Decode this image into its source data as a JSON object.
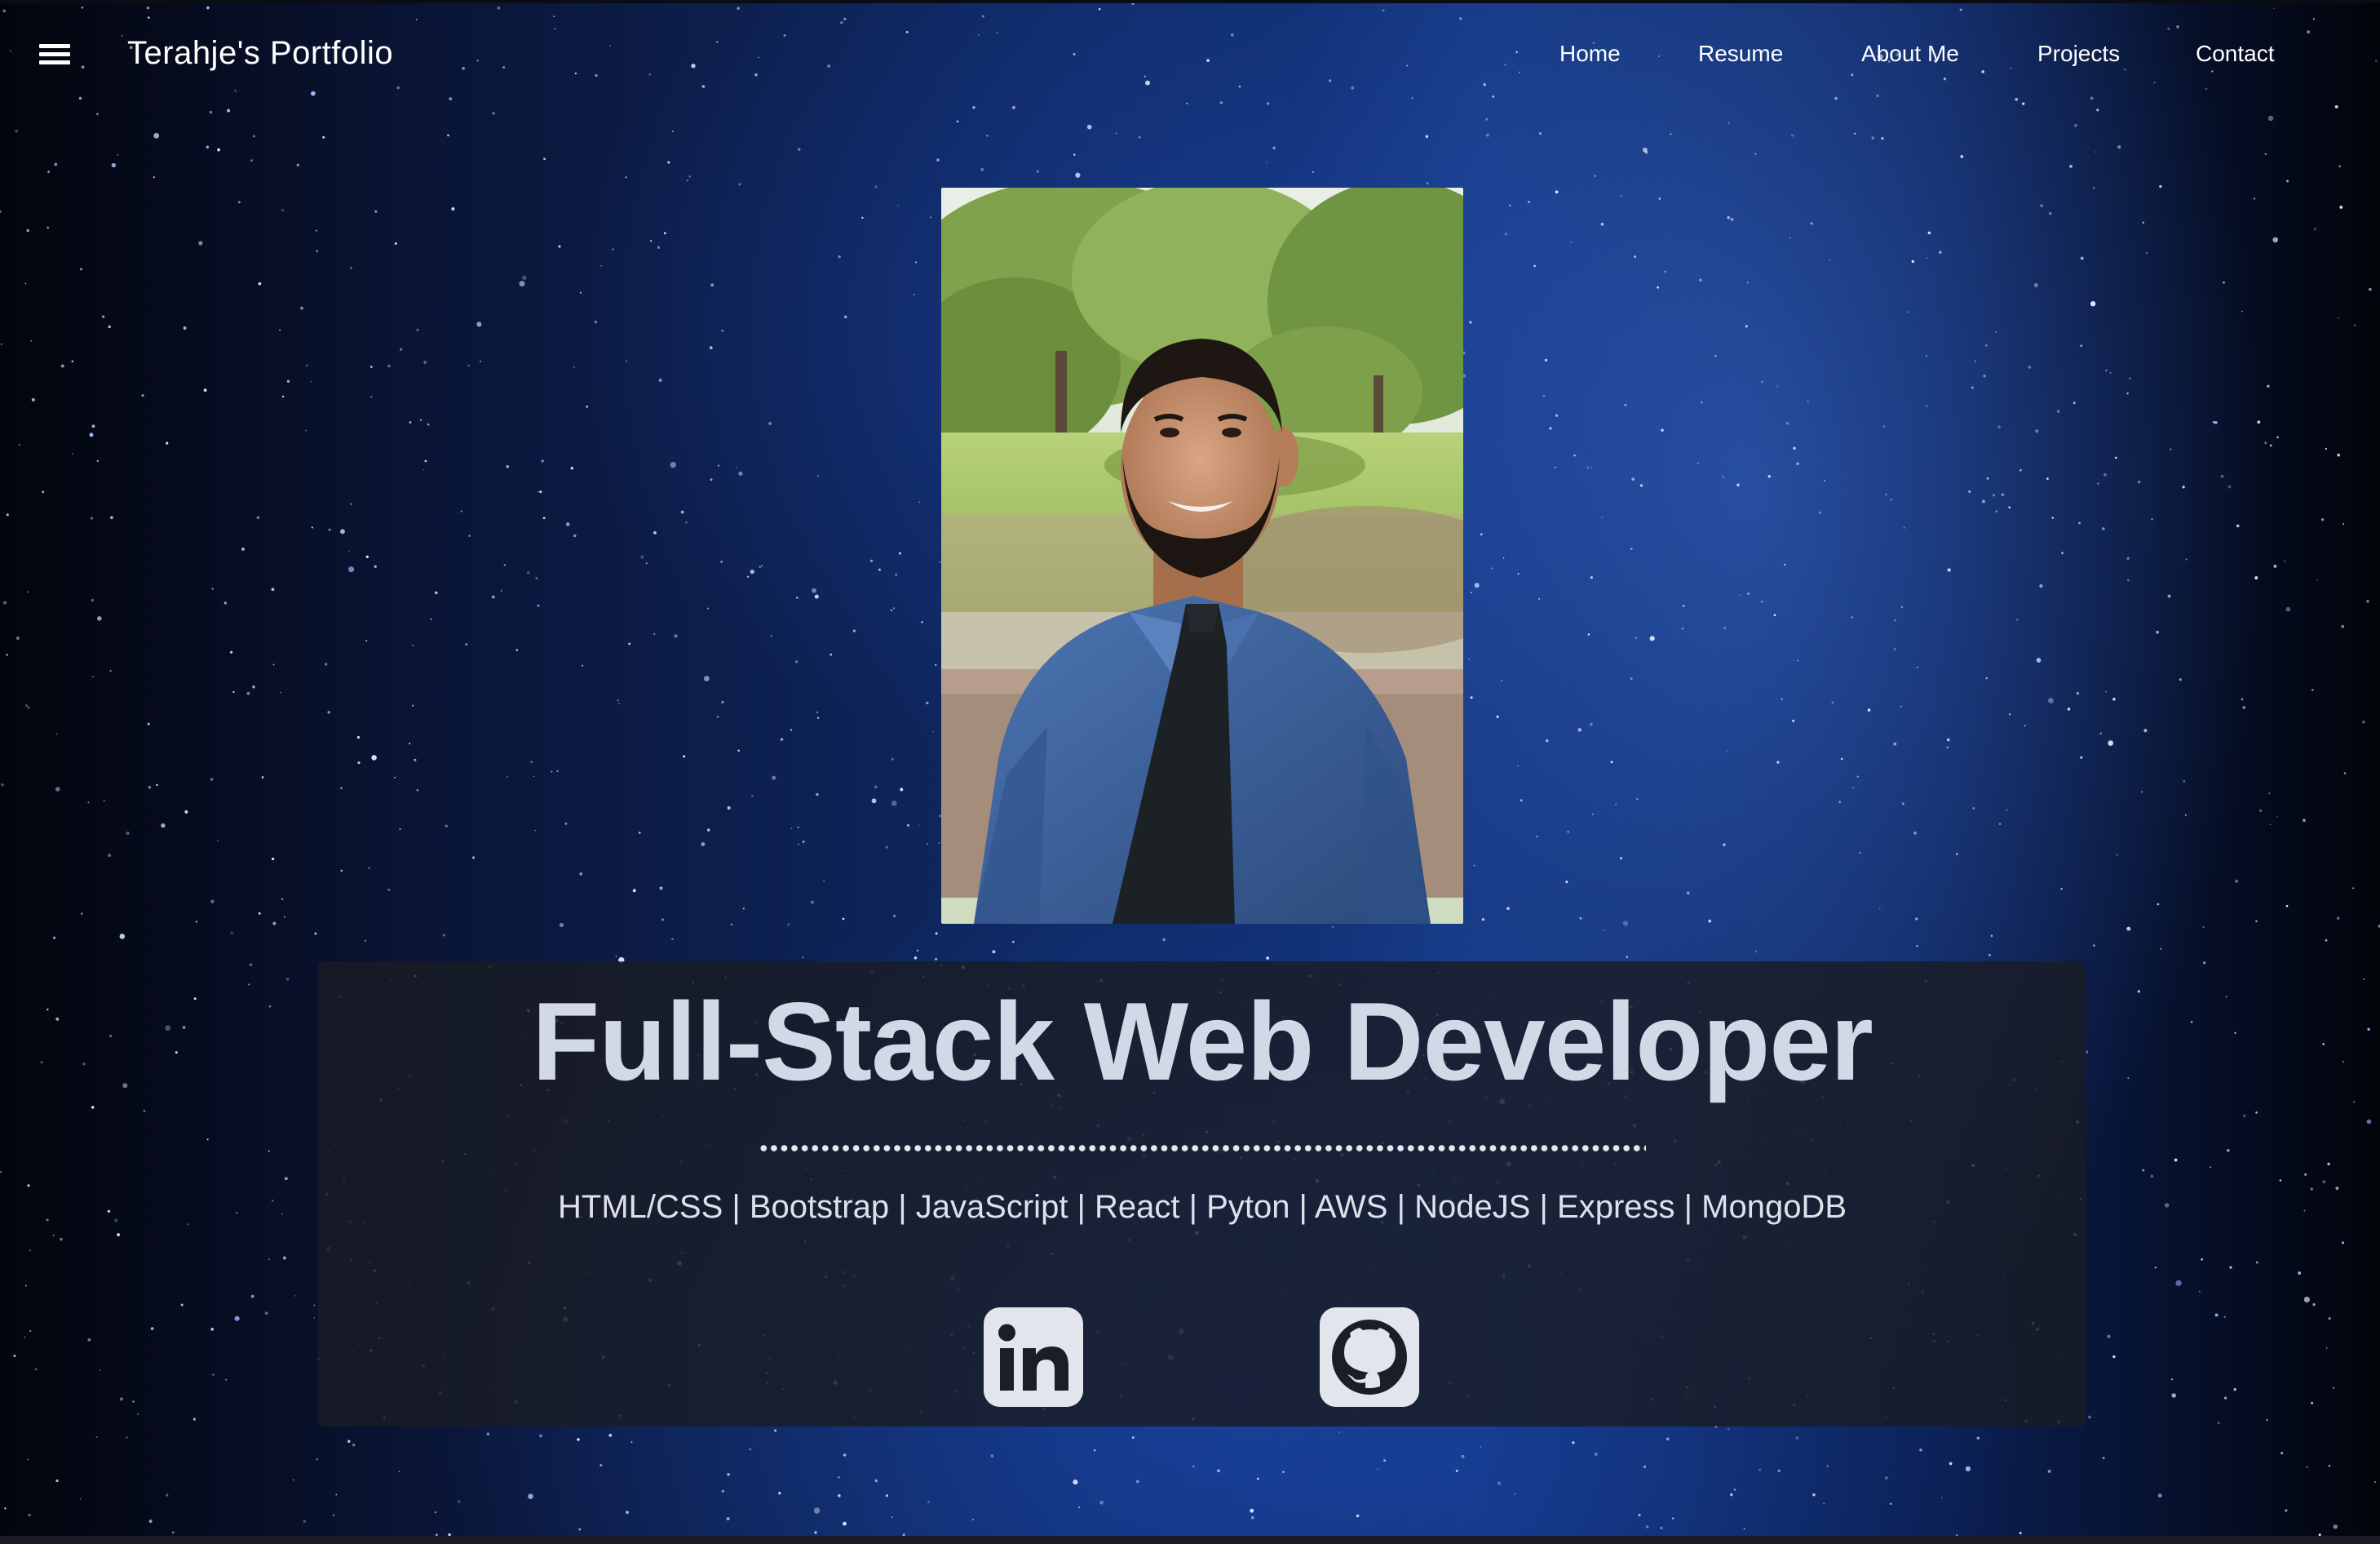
{
  "navbar": {
    "brand": "Terahje's Portfolio",
    "menu_icon": "hamburger-menu-icon",
    "links": [
      {
        "label": "Home"
      },
      {
        "label": "Resume"
      },
      {
        "label": "About Me"
      },
      {
        "label": "Projects"
      },
      {
        "label": "Contact"
      }
    ]
  },
  "hero": {
    "title": "Full-Stack Web Developer",
    "skills": "HTML/CSS | Bootstrap | JavaScript | React | Pyton | AWS | NodeJS | Express | MongoDB",
    "social": [
      {
        "icon": "linkedin-icon"
      },
      {
        "icon": "github-icon"
      }
    ]
  },
  "colors": {
    "background": "#0f2a66",
    "card": "#1a1c24",
    "title": "#d3d8e6",
    "text": "#ffffff",
    "icon_tile": "#e3e5ec"
  }
}
